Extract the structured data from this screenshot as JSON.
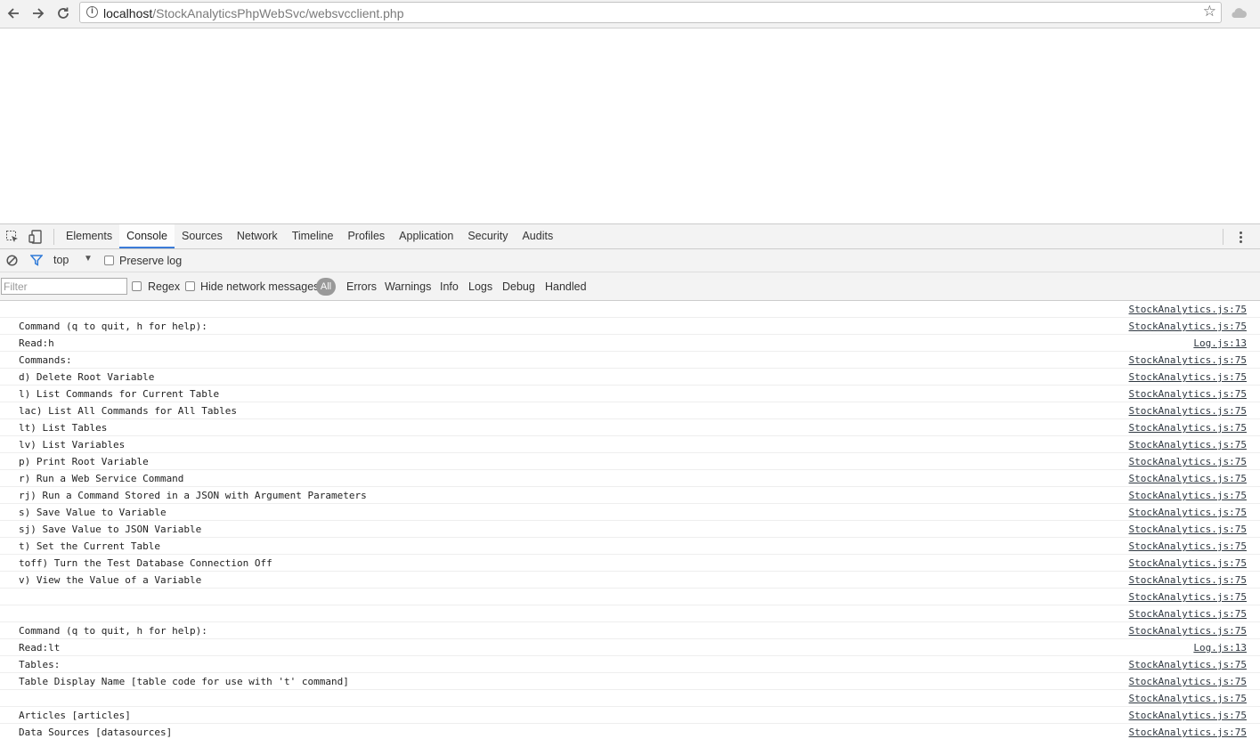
{
  "browser": {
    "url_host": "localhost",
    "url_path": "/StockAnalyticsPhpWebSvc/websvcclient.php"
  },
  "devtools": {
    "tabs": [
      "Elements",
      "Console",
      "Sources",
      "Network",
      "Timeline",
      "Profiles",
      "Application",
      "Security",
      "Audits"
    ],
    "active_tab": "Console",
    "context": "top",
    "preserve_log_label": "Preserve log",
    "filter_placeholder": "Filter",
    "regex_label": "Regex",
    "hide_network_label": "Hide network messages",
    "levels": [
      "All",
      "Errors",
      "Warnings",
      "Info",
      "Logs",
      "Debug",
      "Handled"
    ],
    "active_level": "All"
  },
  "console_lines": [
    {
      "msg": "",
      "src": "StockAnalytics.js:75"
    },
    {
      "msg": "Command (q to quit, h for help):",
      "src": "StockAnalytics.js:75"
    },
    {
      "msg": "Read:h",
      "src": "Log.js:13"
    },
    {
      "msg": "Commands:",
      "src": "StockAnalytics.js:75"
    },
    {
      "msg": "d) Delete Root Variable",
      "src": "StockAnalytics.js:75"
    },
    {
      "msg": "l) List Commands for Current Table",
      "src": "StockAnalytics.js:75"
    },
    {
      "msg": "lac) List All Commands for All Tables",
      "src": "StockAnalytics.js:75"
    },
    {
      "msg": "lt) List Tables",
      "src": "StockAnalytics.js:75"
    },
    {
      "msg": "lv) List Variables",
      "src": "StockAnalytics.js:75"
    },
    {
      "msg": "p) Print Root Variable",
      "src": "StockAnalytics.js:75"
    },
    {
      "msg": "r) Run a Web Service Command",
      "src": "StockAnalytics.js:75"
    },
    {
      "msg": "rj) Run a Command Stored in a JSON with Argument Parameters",
      "src": "StockAnalytics.js:75"
    },
    {
      "msg": "s) Save Value to Variable",
      "src": "StockAnalytics.js:75"
    },
    {
      "msg": "sj) Save Value to JSON Variable",
      "src": "StockAnalytics.js:75"
    },
    {
      "msg": "t) Set the Current Table",
      "src": "StockAnalytics.js:75"
    },
    {
      "msg": "toff) Turn the Test Database Connection Off",
      "src": "StockAnalytics.js:75"
    },
    {
      "msg": "v) View the Value of a Variable",
      "src": "StockAnalytics.js:75"
    },
    {
      "msg": "",
      "src": "StockAnalytics.js:75"
    },
    {
      "msg": "",
      "src": "StockAnalytics.js:75"
    },
    {
      "msg": "Command (q to quit, h for help):",
      "src": "StockAnalytics.js:75"
    },
    {
      "msg": "Read:lt",
      "src": "Log.js:13"
    },
    {
      "msg": "Tables:",
      "src": "StockAnalytics.js:75"
    },
    {
      "msg": "Table Display Name [table code for use with 't' command]",
      "src": "StockAnalytics.js:75"
    },
    {
      "msg": "",
      "src": "StockAnalytics.js:75"
    },
    {
      "msg": "Articles [articles]",
      "src": "StockAnalytics.js:75"
    },
    {
      "msg": "Data Sources [datasources]",
      "src": "StockAnalytics.js:75"
    }
  ]
}
